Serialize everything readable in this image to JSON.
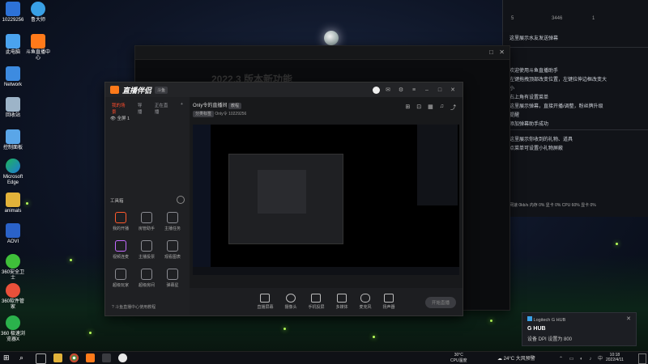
{
  "desktop": {
    "icons": [
      {
        "label": "10229256"
      },
      {
        "label": "鲁大师"
      },
      {
        "label": "此电脑"
      },
      {
        "label": "斗鱼直播中心"
      },
      {
        "label": "Network"
      },
      {
        "label": "回收站"
      },
      {
        "label": "控制面板"
      },
      {
        "label": "Microsoft Edge"
      },
      {
        "label": "animals"
      },
      {
        "label": "AOVI"
      },
      {
        "label": "360安全卫士"
      },
      {
        "label": "360软件管家"
      },
      {
        "label": "360 极速浏览器X"
      }
    ]
  },
  "right_panel": {
    "counts": [
      "5",
      "3446",
      "1"
    ],
    "lines": [
      "这里展示水友发送弹幕",
      "欢迎使用斗鱼直播助手",
      "左键拖拽顶部改变位置，左键拉伸边框改变大",
      "小",
      "右上角有设置菜单",
      "这里展示弹幕，直接开播/调整，粉丝牌升级",
      "提醒",
      "添加弹幕助手成功",
      "这里展示你收到的礼物、道具",
      "点菜单可设置小礼物屏蔽"
    ],
    "status": "网速 0kb/s  内存 0% 显卡 0%  CPU 60% 显卡 0%"
  },
  "obs_window": {
    "bg_title": "2022.3 版本新功能"
  },
  "live_app": {
    "logo": "直播伴侣",
    "badge": "斗鱼",
    "sidebar_tabs": [
      "我的场景",
      "导播",
      "正在直播"
    ],
    "scene_item": "全屏 1",
    "toolbox_label": "工具箱",
    "tools": [
      "我的开播",
      "房管助手",
      "主播任务",
      "视频连麦",
      "主播投票",
      "观看图表",
      "超级玩家",
      "超级房间",
      "弹幕星"
    ],
    "footer_link": "斗鱼直播中心使用教程",
    "channel_title": "Only令的直播间",
    "channel_tag": "教程",
    "channel_sub": "分类标签",
    "room_id": "10229256",
    "room_id_prefix": "Only令",
    "bottom_tools": [
      "直播屏幕",
      "摄像头",
      "手机投屏",
      "多媒体",
      "麦克风",
      "扬声器"
    ],
    "start_label": "开始直播"
  },
  "notification": {
    "app": "Logitech G HUB",
    "title": "G HUB",
    "body": "设备 DPI 设置为 800"
  },
  "taskbar": {
    "weather_temp": "30°C",
    "weather_text": "CPU温度",
    "temp": "24°C",
    "weather": "大风预警",
    "time": "10:18",
    "date": "2022/4/11"
  }
}
